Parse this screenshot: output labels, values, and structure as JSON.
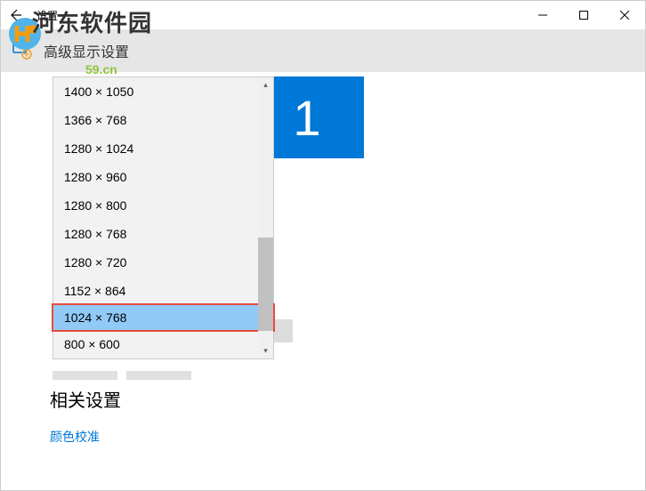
{
  "window": {
    "title": "设置"
  },
  "subheader": {
    "text": "高级显示设置"
  },
  "watermark": {
    "text": "河东软件园",
    "url": "59.cn"
  },
  "monitor": {
    "number": "1"
  },
  "resolutions": {
    "items": [
      "1400 × 1050",
      "1366 × 768",
      "1280 × 1024",
      "1280 × 960",
      "1280 × 800",
      "1280 × 768",
      "1280 × 720",
      "1152 × 864",
      "1024 × 768",
      "800 × 600"
    ],
    "highlighted_index": 8
  },
  "related": {
    "heading": "相关设置",
    "link": "颜色校准"
  }
}
